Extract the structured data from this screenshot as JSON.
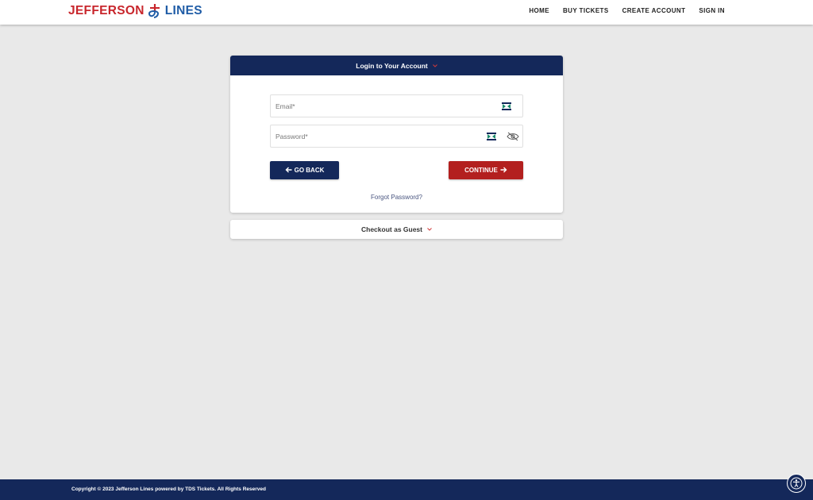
{
  "brand": {
    "word1": "JEFFERSON",
    "word2": "LINES",
    "colors": {
      "red": "#c8262c",
      "blue": "#1f5ca6",
      "navy": "#14285a"
    }
  },
  "nav": {
    "items": [
      {
        "label": "HOME"
      },
      {
        "label": "BUY TICKETS"
      },
      {
        "label": "CREATE ACCOUNT"
      },
      {
        "label": "SIGN IN"
      }
    ]
  },
  "login": {
    "title": "Login to Your Account",
    "email_placeholder": "Email*",
    "email_value": "",
    "password_placeholder": "Password*",
    "password_value": "",
    "back_label": "GO BACK",
    "continue_label": "CONTINUE",
    "forgot_label": "Forgot Password?",
    "icons": [
      "password-manager-icon",
      "eye-off-icon",
      "arrow-left-icon",
      "arrow-right-icon",
      "chevron-down-icon"
    ]
  },
  "guest": {
    "label": "Checkout as Guest"
  },
  "footer": {
    "copyright": "Copyright © 2023 Jefferson Lines powered by TDS Tickets. All Rights Reserved",
    "accessibility_icon": "accessibility-icon"
  }
}
